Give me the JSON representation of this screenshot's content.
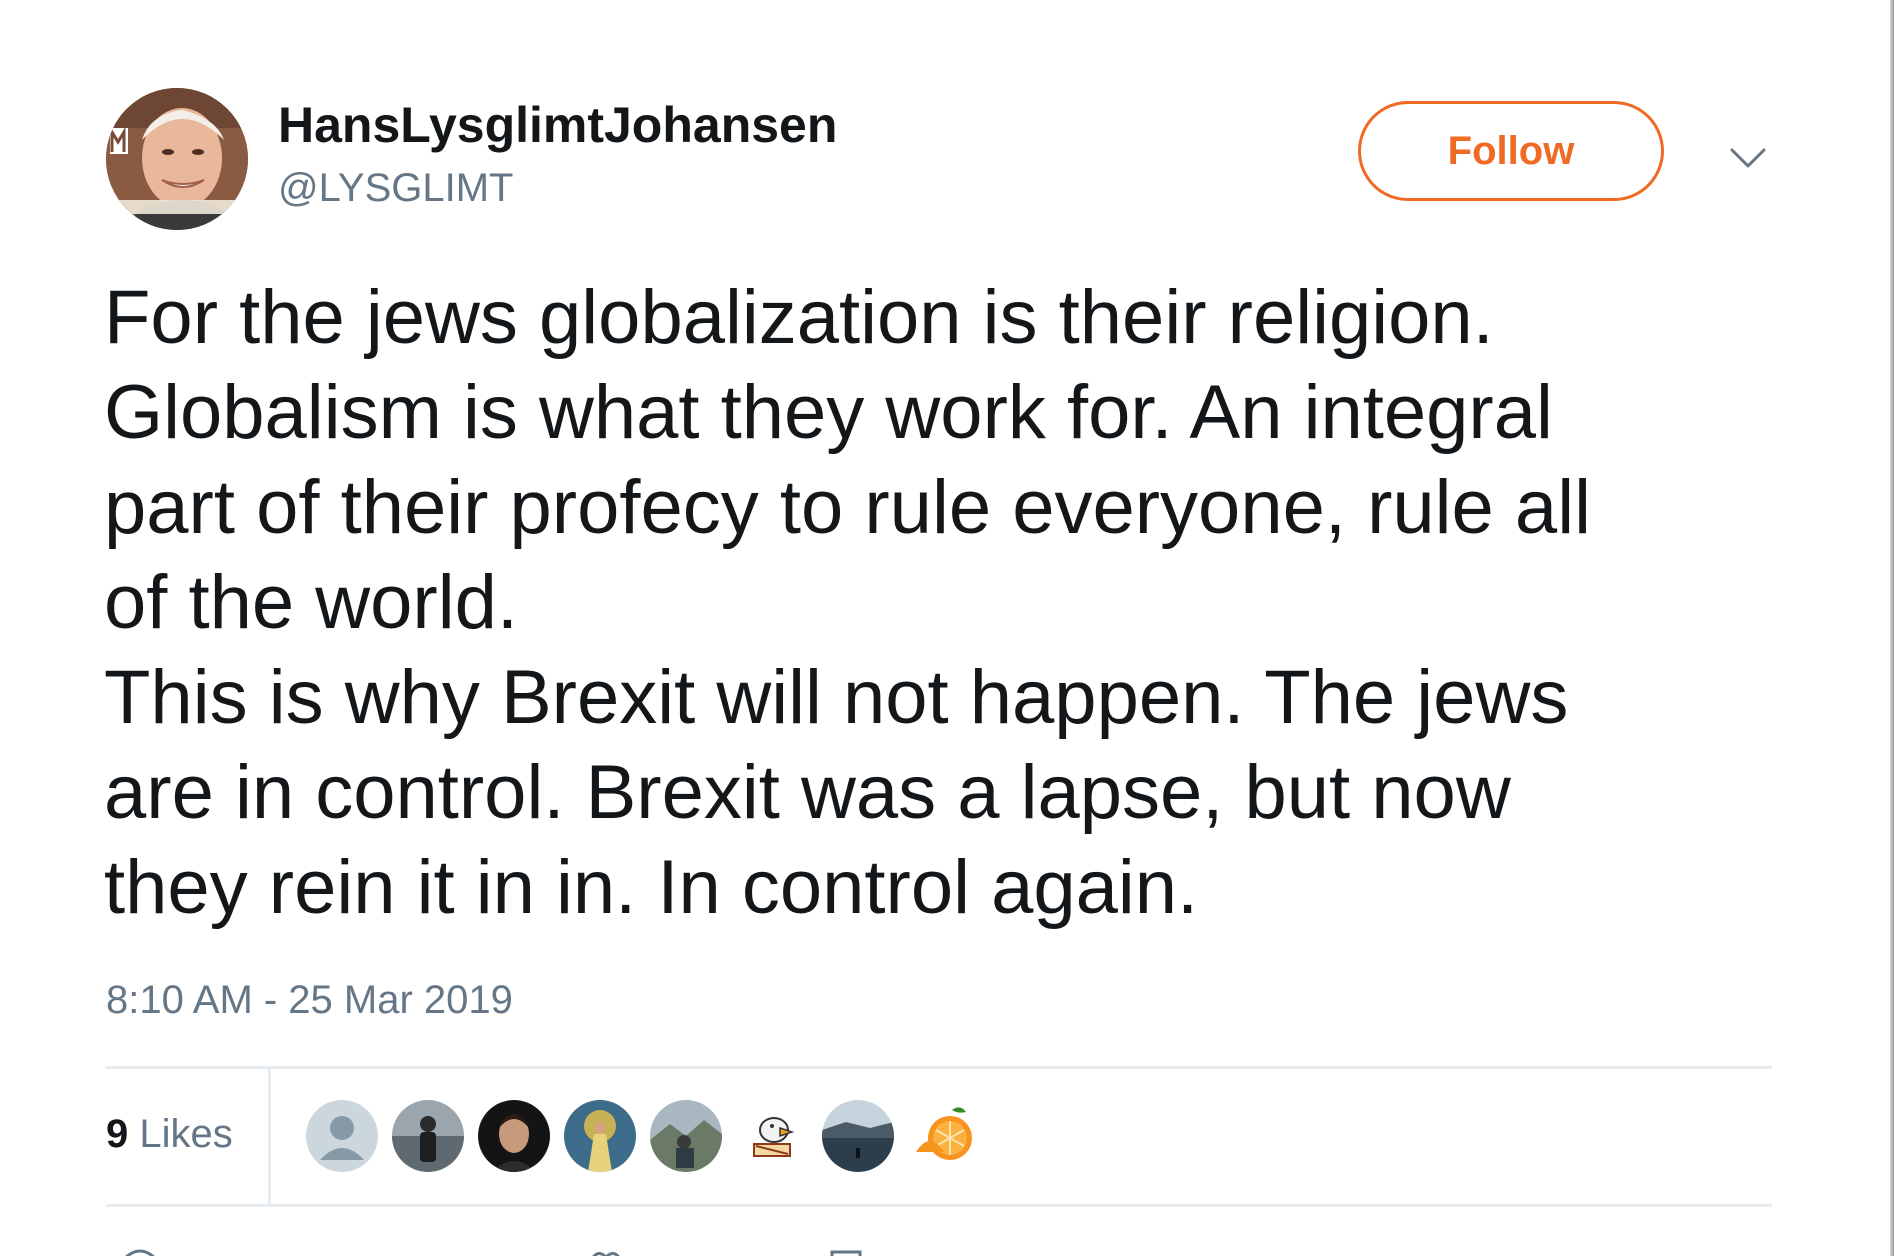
{
  "tweet": {
    "author": {
      "display_name": "HansLysglimtJohansen",
      "handle": "@LYSGLIMT",
      "avatar_icon": "profile-photo"
    },
    "follow_label": "Follow",
    "caret_icon": "chevron-down-icon",
    "text": "For the jews globalization is their religion.\nGlobalism is what they work for. An integral\npart of their profecy to rule everyone, rule all\nof the world.\nThis is why Brexit will not happen. The jews\nare in control. Brexit was a lapse, but now\nthey rein it in in. In control again.",
    "timestamp": "8:10 AM - 25 Mar 2019",
    "stats": {
      "likes_count": "9",
      "likes_label": "Likes"
    },
    "likers": [
      {
        "icon": "default-avatar"
      },
      {
        "icon": "person-photo"
      },
      {
        "icon": "man-portrait-photo"
      },
      {
        "icon": "painting-photo"
      },
      {
        "icon": "landscape-person-photo"
      },
      {
        "icon": "cartoon-emblem"
      },
      {
        "icon": "lake-landscape-photo"
      },
      {
        "icon": "orange-slices-photo"
      }
    ]
  },
  "colors": {
    "accent": "#ef6a24",
    "text_primary": "#14171a",
    "text_secondary": "#657786",
    "divider": "#e6ecf0"
  }
}
